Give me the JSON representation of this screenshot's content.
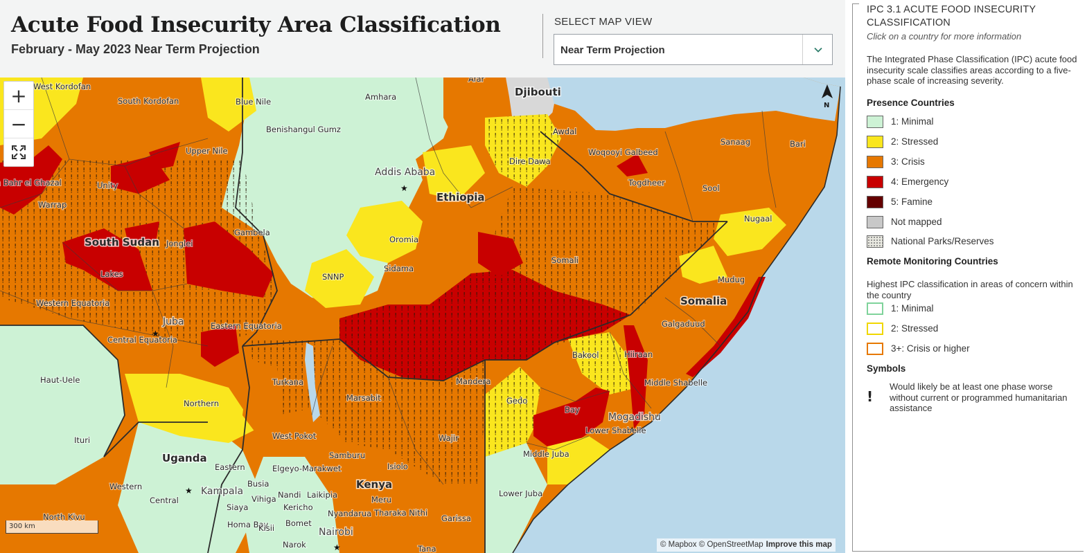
{
  "header": {
    "title": "Acute Food Insecurity Area Classification",
    "subtitle": "February - May 2023 Near Term Projection",
    "view_label": "SELECT MAP VIEW",
    "view_value": "Near Term Projection"
  },
  "legend": {
    "title": "IPC 3.1 ACUTE FOOD INSECURITY CLASSIFICATION",
    "hint": "Click on a country for more information",
    "description": "The Integrated Phase Classification (IPC) acute food insecurity scale classifies areas according to a five-phase scale of increasing severity.",
    "presence_heading": "Presence Countries",
    "presence_items": [
      {
        "label": "1: Minimal",
        "color": "#cdf2d5"
      },
      {
        "label": "2: Stressed",
        "color": "#fae61e"
      },
      {
        "label": "3: Crisis",
        "color": "#e67800"
      },
      {
        "label": "4: Emergency",
        "color": "#c80000"
      },
      {
        "label": "5: Famine",
        "color": "#640000"
      },
      {
        "label": "Not mapped",
        "color": "#c8c8c8"
      },
      {
        "label": "National Parks/Reserves",
        "color": "#e8e8e0"
      }
    ],
    "remote_heading": "Remote Monitoring Countries",
    "remote_note": "Highest IPC classification in areas of concern within the country",
    "remote_items": [
      {
        "label": "1: Minimal",
        "color": "#cdf2d5"
      },
      {
        "label": "2: Stressed",
        "color": "#fae61e"
      },
      {
        "label": "3+: Crisis or higher",
        "color": "#e67800"
      }
    ],
    "symbols_heading": "Symbols",
    "symbol_glyph": "!",
    "symbol_text": "Would likely be at least one phase worse without current or programmed humanitarian assistance"
  },
  "map": {
    "zoom_in": "+",
    "zoom_out": "−",
    "fullscreen": "⛶",
    "scale": "300 km",
    "attribution": "© Mapbox © OpenStreetMap",
    "improve": "Improve this map",
    "north": "N",
    "countries": [
      "Ethiopia",
      "Somalia",
      "Kenya",
      "Uganda",
      "South Sudan",
      "Djibouti"
    ],
    "cities": [
      "Addis Ababa",
      "Mogadishu",
      "Kampala",
      "Nairobi",
      "Juba"
    ],
    "regions": [
      "West Kordofan",
      "South Kordofan",
      "Blue Nile",
      "Amhara",
      "Afar",
      "Benishangul Gumz",
      "Upper Nile",
      "Unity",
      "Warrap",
      "Jonglei",
      "Lakes",
      "Gambela",
      "Oromia",
      "Sidama",
      "SNNP",
      "Western Equatoria",
      "Central Equatoria",
      "Eastern Equatoria",
      "Haut-Uele",
      "Northern",
      "Ituri",
      "Western",
      "Central",
      "Eastern",
      "North Kivu",
      "Turkana",
      "Marsabit",
      "Mandera",
      "Wajir",
      "West Pokot",
      "Samburu",
      "Isiolo",
      "Elgeyo-Marakwet",
      "Busia",
      "Vihiga",
      "Siaya",
      "Homa Bay",
      "Kisii",
      "Nandi",
      "Kericho",
      "Laikipia",
      "Nyandarua",
      "Meru",
      "Tharaka Nithi",
      "Bomet",
      "Narok",
      "Garissa",
      "Tana",
      "Awdal",
      "Woqooyi Galbeed",
      "Togdheer",
      "Sanaag",
      "Bari",
      "Sool",
      "Nugaal",
      "Mudug",
      "Galgaduud",
      "Hiiraan",
      "Bakool",
      "Gedo",
      "Bay",
      "Middle Shabelle",
      "Lower Shabelle",
      "Middle Juba",
      "Lower Juba",
      "Dire Dawa",
      "Somali",
      "Northern Bahr el Ghazal"
    ]
  }
}
